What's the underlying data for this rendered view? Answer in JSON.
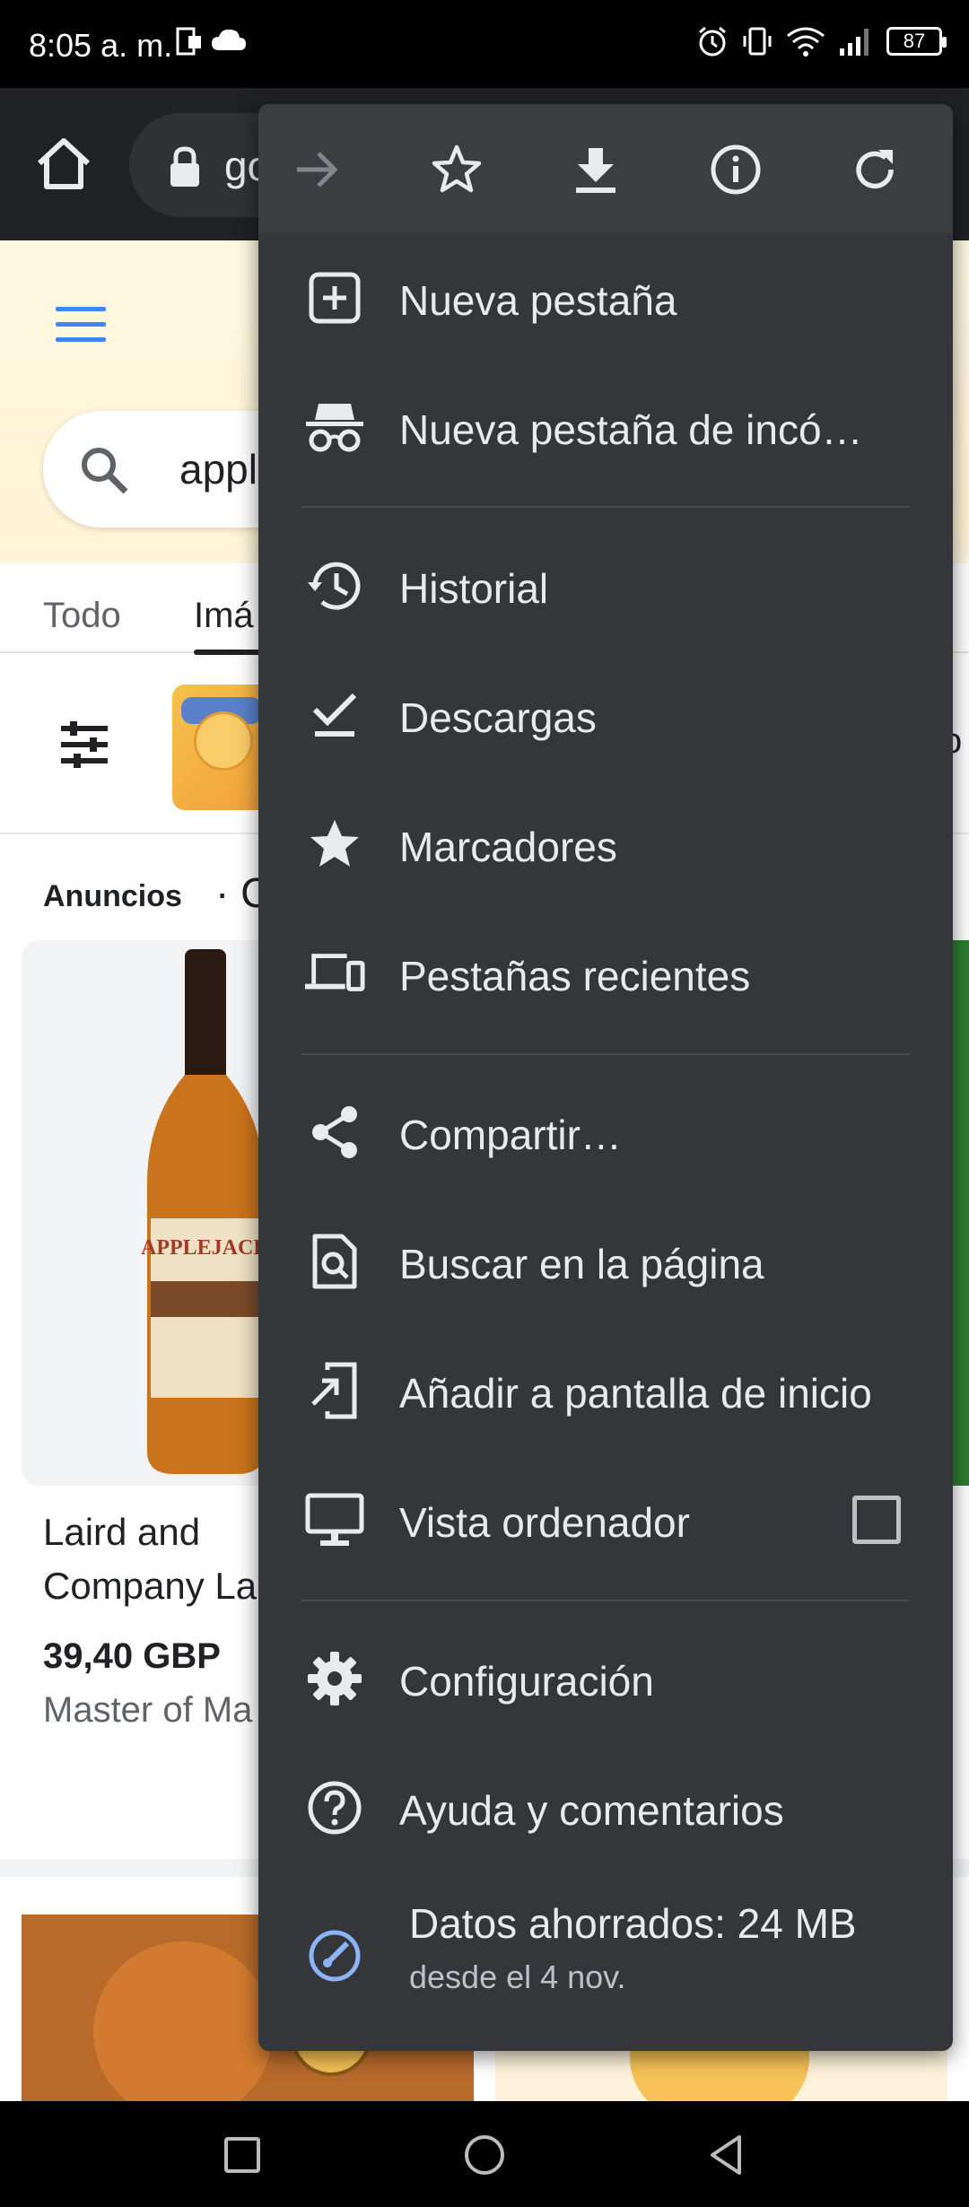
{
  "status_bar": {
    "time": "8:05 a. m.",
    "battery": "87"
  },
  "toolbar": {
    "url": "go"
  },
  "page": {
    "search_query": "appl",
    "tabs": [
      "Todo",
      "Imá"
    ],
    "ads_label": "Anuncios",
    "ads_title": "· Co",
    "right_edge_letter": "o",
    "product": {
      "name": "Laird and Company La",
      "price": "39,40 GBP",
      "store": "Master of Ma"
    }
  },
  "menu": {
    "top_icons": [
      "forward-icon",
      "star-icon",
      "download-icon",
      "info-icon",
      "refresh-icon"
    ],
    "items": [
      {
        "label": "Nueva pestaña",
        "icon": "new-tab-icon"
      },
      {
        "label": "Nueva pestaña de incó…",
        "icon": "incognito-icon"
      },
      {
        "label": "Historial",
        "icon": "history-icon"
      },
      {
        "label": "Descargas",
        "icon": "downloads-icon"
      },
      {
        "label": "Marcadores",
        "icon": "bookmarks-icon"
      },
      {
        "label": "Pestañas recientes",
        "icon": "devices-icon"
      },
      {
        "label": "Compartir…",
        "icon": "share-icon"
      },
      {
        "label": "Buscar en la página",
        "icon": "find-in-page-icon"
      },
      {
        "label": "Añadir a pantalla de inicio",
        "icon": "add-to-home-icon"
      },
      {
        "label": "Vista ordenador",
        "icon": "desktop-icon",
        "checked": false
      },
      {
        "label": "Configuración",
        "icon": "settings-icon"
      },
      {
        "label": "Ayuda y comentarios",
        "icon": "help-icon"
      }
    ],
    "data_saved": {
      "main": "Datos ahorrados: 24 MB",
      "sub": "desde el 4 nov."
    }
  },
  "colors": {
    "menu_bg": "#35363a",
    "menu_text": "#e8eaed",
    "accent": "#8ab4f8"
  }
}
